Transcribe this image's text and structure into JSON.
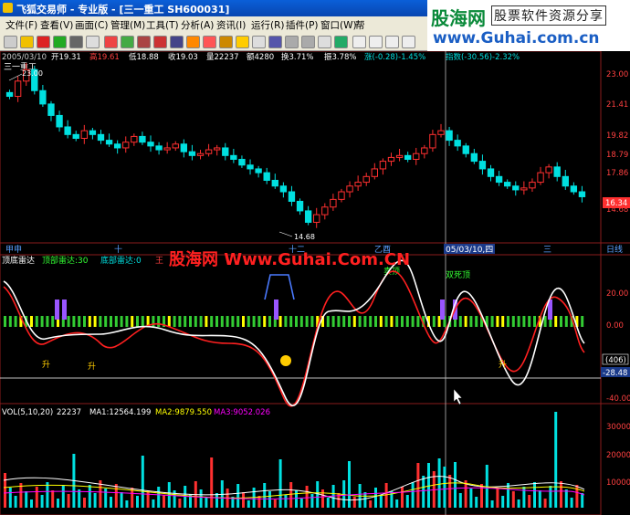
{
  "window": {
    "title": "飞狐交易师 - 专业版 - [三一重工 SH600031]"
  },
  "menu": [
    "文件(F)",
    "查看(V)",
    "画面(C)",
    "管理(M)",
    "工具(T)",
    "分析(A)",
    "资讯(I)",
    "运行(R)",
    "插件(P)",
    "窗口(W)",
    "帮"
  ],
  "logo": {
    "brand": "股海网",
    "tagline": "股票软件资源分享",
    "url": "www.Guhai.com.cn"
  },
  "watermark": "股海网 Www.Guhai.Com.CN",
  "info_bar": {
    "date": "2005/03/10",
    "open": "开19.31",
    "high": "高19.61",
    "low": "低18.88",
    "close": "收19.03",
    "vol": "量22237",
    "amount": "额4280",
    "turnover": "换3.71%",
    "amp": "振3.78%",
    "change": "涨(-0.28)-1.45%",
    "index": "指数(-30.56)-2.32%"
  },
  "main_panel": {
    "name": "三一重工",
    "high_marker": "23.00",
    "low_marker": "14.68",
    "last_price": "16.34",
    "y_ticks": [
      "23.00",
      "21.41",
      "19.82",
      "18.79",
      "17.86",
      "16.34",
      "14.68"
    ],
    "time_labels": [
      "甲申",
      "十",
      "十二",
      "乙酉",
      "05/03/10,四",
      "三",
      "日线"
    ]
  },
  "indicator_panel": {
    "name": "顶底雷达",
    "line1": "顶部雷达:30",
    "line2": "底部雷达:0",
    "line3": "王",
    "top_labels": [
      "卖顶",
      "双死顶"
    ],
    "sell_text": "卖",
    "rise_label": "升",
    "value_box": "(406)",
    "current_value": "-28.48",
    "y_ticks": [
      "20.00",
      "0.00",
      "-40.00"
    ]
  },
  "volume_panel": {
    "name": "VOL(5,10,20)",
    "vol": "22237",
    "ma1": "MA1:12564.199",
    "ma2": "MA2:9879.550",
    "ma3": "MA3:9052.026",
    "y_ticks": [
      "30000",
      "20000",
      "10000"
    ]
  },
  "colors": {
    "up": "#ff3030",
    "down": "#00e0e0",
    "grid": "#8a1c1c",
    "ma1": "#ffffff",
    "ma2": "#ffff00",
    "ma3": "#ff00ff"
  },
  "chart_data": {
    "type": "candlestick",
    "series": [
      {
        "name": "三一重工",
        "values": [
          21.6,
          22.4,
          23.0,
          21.9,
          21.2,
          20.6,
          20.0,
          19.6,
          19.4,
          19.8,
          19.6,
          19.3,
          19.1,
          18.9,
          19.2,
          19.5,
          19.2,
          19.0,
          18.8,
          18.9,
          19.1,
          18.7,
          18.5,
          18.6,
          18.8,
          18.9,
          18.5,
          18.3,
          18.0,
          17.8,
          17.6,
          17.2,
          16.9,
          16.6,
          16.1,
          15.6,
          15.0,
          15.4,
          15.8,
          16.2,
          16.6,
          16.9,
          17.1,
          17.4,
          17.8,
          18.2,
          18.4,
          18.5,
          18.3,
          18.6,
          18.9,
          19.6,
          19.8,
          19.3,
          19.0,
          18.6,
          18.2,
          17.8,
          17.4,
          17.1,
          16.9,
          16.7,
          16.8,
          17.1,
          17.6,
          17.9,
          17.4,
          16.9,
          16.6,
          16.34
        ]
      }
    ]
  }
}
